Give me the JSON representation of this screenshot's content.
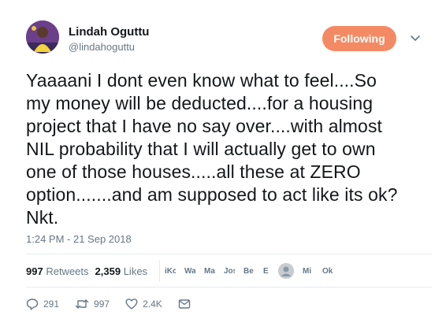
{
  "author": {
    "name": "Lindah Oguttu",
    "handle": "@lindahoguttu"
  },
  "follow_button": {
    "label": "Following",
    "color": "#f38a64"
  },
  "tweet": {
    "lines": [
      "Yaaaani I dont even know what to feel....So",
      "my money will be deducted....for a housing",
      "project that I have no say over....with almost",
      "NIL probability that I will actually get to own",
      "one of those houses.....all these at ZERO",
      "option.......and am supposed to act like its ok?",
      "Nkt."
    ],
    "timestamp": "1:24 PM - 21 Sep 2018"
  },
  "stats": {
    "retweets_count": "997",
    "retweets_label": "Retweets",
    "likes_count": "2,359",
    "likes_label": "Likes"
  },
  "likers": [
    "iKc",
    "Wa",
    "Ma",
    "Jos",
    "Be",
    "E",
    "",
    "Mi",
    "Ok"
  ],
  "actions": {
    "replies": "291",
    "retweets": "997",
    "likes": "2.4K"
  }
}
